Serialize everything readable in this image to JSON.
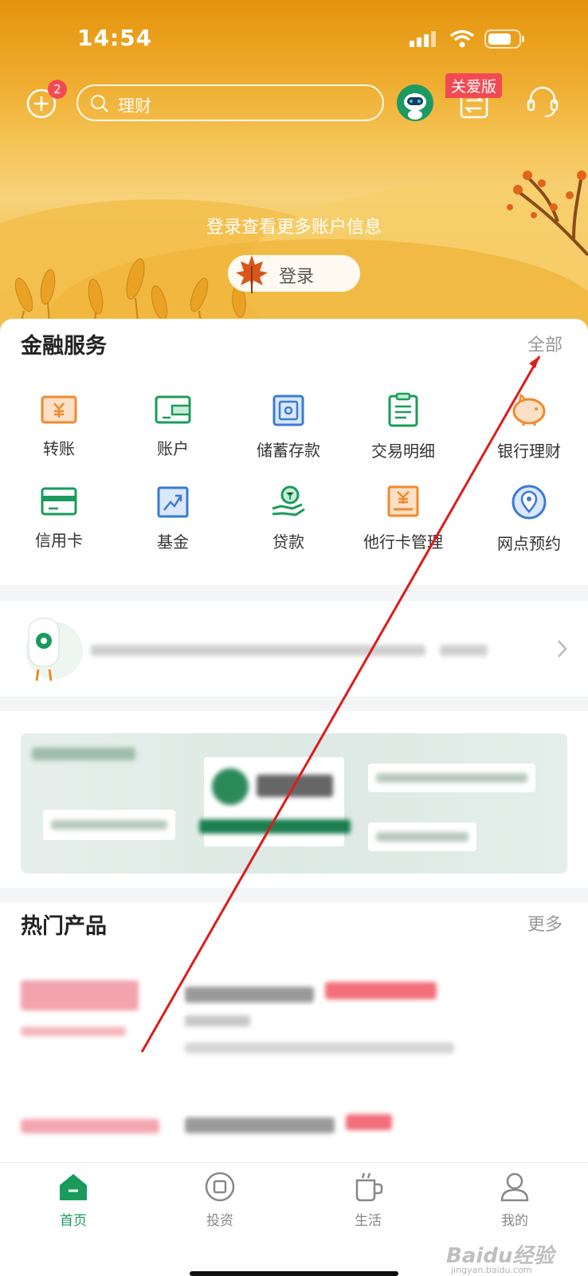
{
  "status_bar": {
    "time": "14:54"
  },
  "header": {
    "add_badge_count": "2",
    "search_placeholder": "理财",
    "care_mode_label": "关爱版",
    "login_tip": "登录查看更多账户信息",
    "login_button": "登录"
  },
  "financial_services": {
    "title": "金融服务",
    "all_label": "全部",
    "items": [
      {
        "label": "转账",
        "icon": "transfer-icon"
      },
      {
        "label": "账户",
        "icon": "wallet-icon"
      },
      {
        "label": "储蓄存款",
        "icon": "safe-icon"
      },
      {
        "label": "交易明细",
        "icon": "clipboard-icon"
      },
      {
        "label": "银行理财",
        "icon": "piggy-bank-icon"
      },
      {
        "label": "信用卡",
        "icon": "credit-card-icon"
      },
      {
        "label": "基金",
        "icon": "chart-up-icon"
      },
      {
        "label": "贷款",
        "icon": "loan-hand-icon"
      },
      {
        "label": "他行卡管理",
        "icon": "card-manage-icon"
      },
      {
        "label": "网点预约",
        "icon": "location-pin-icon"
      }
    ]
  },
  "hot_products": {
    "title": "热门产品",
    "more_label": "更多"
  },
  "bottom_nav": {
    "items": [
      {
        "label": "首页",
        "icon": "home-icon",
        "active": true
      },
      {
        "label": "投资",
        "icon": "invest-icon",
        "active": false
      },
      {
        "label": "生活",
        "icon": "coffee-cup-icon",
        "active": false
      },
      {
        "label": "我的",
        "icon": "user-icon",
        "active": false
      }
    ]
  },
  "watermark": {
    "text": "Baidu经验",
    "sub": "jingyan.baidu.com"
  },
  "colors": {
    "brand_green": "#1a9b5b",
    "orange": "#f08a2c",
    "blue": "#3a7bd5",
    "red_badge": "#f24a53",
    "annotation_red": "#e01a1a"
  }
}
